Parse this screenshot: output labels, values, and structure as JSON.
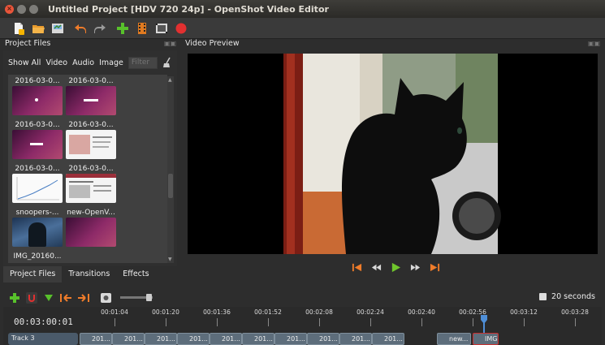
{
  "window": {
    "title": "Untitled Project [HDV 720 24p] - OpenShot Video Editor"
  },
  "toolbar": {
    "icons": [
      "new-project-icon",
      "open-project-icon",
      "save-project-icon",
      "undo-icon",
      "redo-icon",
      "import-files-icon",
      "choose-profile-icon",
      "fullscreen-icon",
      "export-video-icon"
    ],
    "accent_colors": {
      "undo": "#f07c2a",
      "add": "#58c12b",
      "record": "#e23030"
    }
  },
  "project_files": {
    "title": "Project Files",
    "filters": {
      "show_all": "Show All",
      "video": "Video",
      "audio": "Audio",
      "image": "Image",
      "placeholder": "Filter"
    },
    "items": [
      {
        "label": "2016-03-0...",
        "thumb": "ubuntu"
      },
      {
        "label": "2016-03-0...",
        "thumb": "ubuntu"
      },
      {
        "label": "2016-03-0...",
        "thumb": "ubuntu"
      },
      {
        "label": "2016-03-0...",
        "thumb": "ubuntu"
      },
      {
        "label": "2016-03-0...",
        "thumb": "web"
      },
      {
        "label": "2016-03-0...",
        "thumb": "web"
      },
      {
        "label": "snoopers-...",
        "thumb": "chart"
      },
      {
        "label": "new-OpenV...",
        "thumb": "web"
      },
      {
        "label": "IMG_20160...",
        "thumb": "cat"
      }
    ],
    "tabs": [
      "Project Files",
      "Transitions",
      "Effects"
    ],
    "active_tab": "Project Files"
  },
  "video_preview": {
    "title": "Video Preview"
  },
  "timeline": {
    "timecode": "00:03:00:01",
    "zoom_label": "20 seconds",
    "ticks": [
      "00:01:04",
      "00:01:20",
      "00:01:36",
      "00:01:52",
      "00:02:08",
      "00:02:24",
      "00:02:40",
      "00:02:56",
      "00:03:12",
      "00:03:28"
    ],
    "track_name": "Track 3",
    "clips": [
      "201...",
      "201...",
      "201...",
      "201...",
      "201...",
      "201...",
      "201...",
      "201...",
      "201...",
      "201...",
      "new...",
      "IMG..."
    ]
  }
}
